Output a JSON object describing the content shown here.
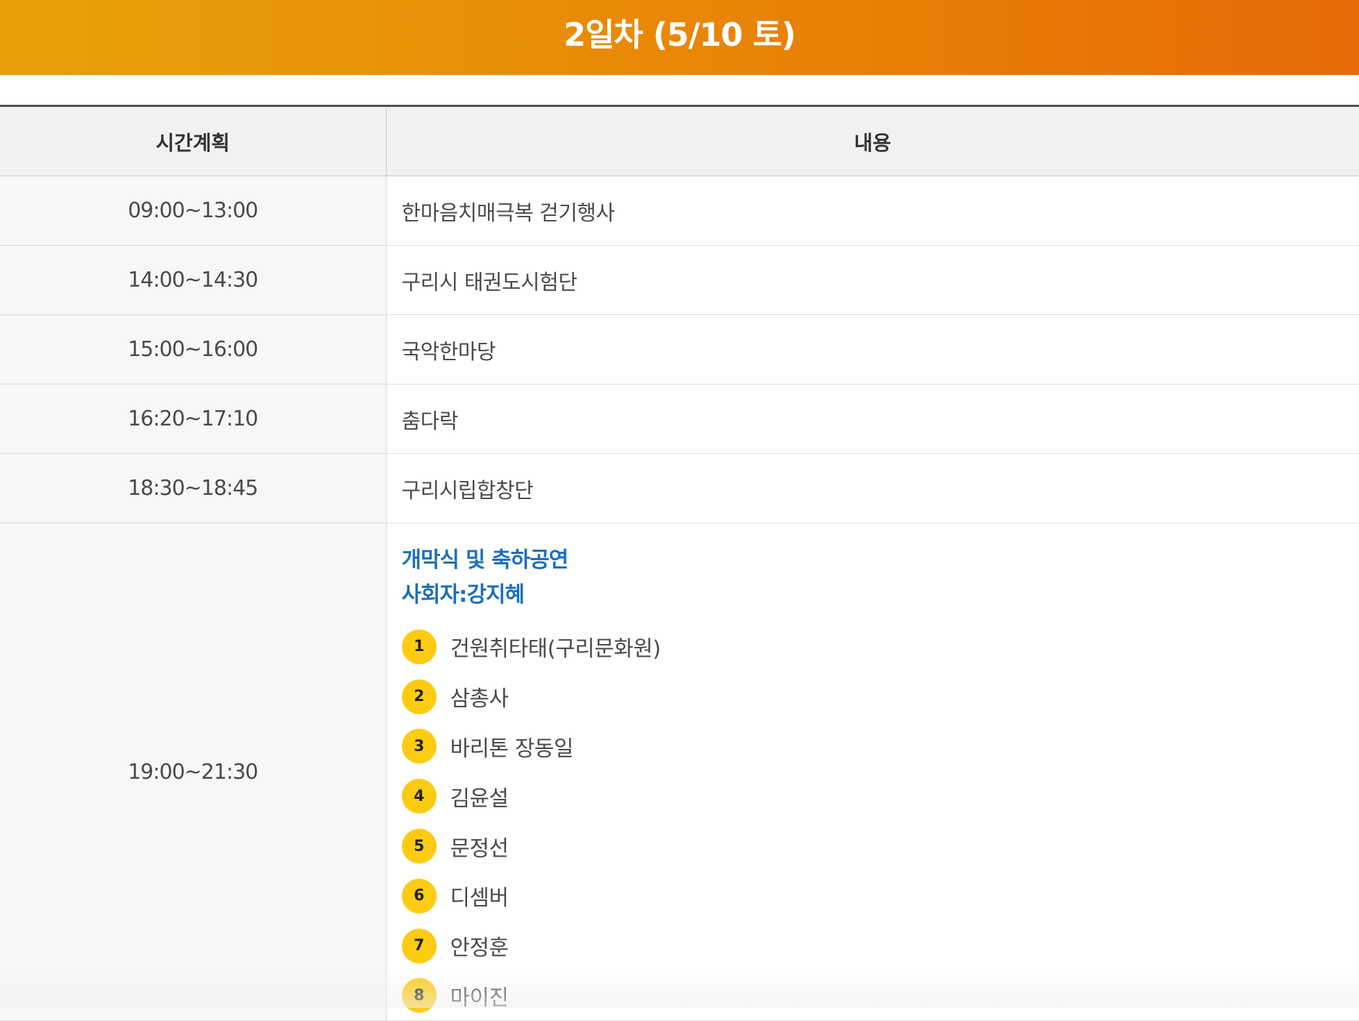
{
  "banner": {
    "title": "2일차 (5/10 토)"
  },
  "table": {
    "headers": {
      "time": "시간계획",
      "content": "내용"
    },
    "rows": [
      {
        "time": "09:00~13:00",
        "content": "한마음치매극복 걷기행사"
      },
      {
        "time": "14:00~14:30",
        "content": "구리시 태권도시험단"
      },
      {
        "time": "15:00~16:00",
        "content": "국악한마당"
      },
      {
        "time": "16:20~17:10",
        "content": "춤다락"
      },
      {
        "time": "18:30~18:45",
        "content": "구리시립합창단"
      }
    ],
    "last": {
      "time": "19:00~21:30",
      "heading1": "개막식 및 축하공연",
      "heading2": "사회자:강지혜",
      "performers": [
        {
          "num": "1",
          "name": "건원취타태(구리문화원)"
        },
        {
          "num": "2",
          "name": "삼총사"
        },
        {
          "num": "3",
          "name": "바리톤 장동일"
        },
        {
          "num": "4",
          "name": "김윤설"
        },
        {
          "num": "5",
          "name": "문정선"
        },
        {
          "num": "6",
          "name": "디셈버"
        },
        {
          "num": "7",
          "name": "안정훈"
        },
        {
          "num": "8",
          "name": "마이진"
        }
      ]
    }
  },
  "colors": {
    "banner_start": "#e8a109",
    "banner_end": "#e66a05",
    "heading_blue": "#1d6fb8",
    "badge_yellow": "#fdcb12"
  }
}
